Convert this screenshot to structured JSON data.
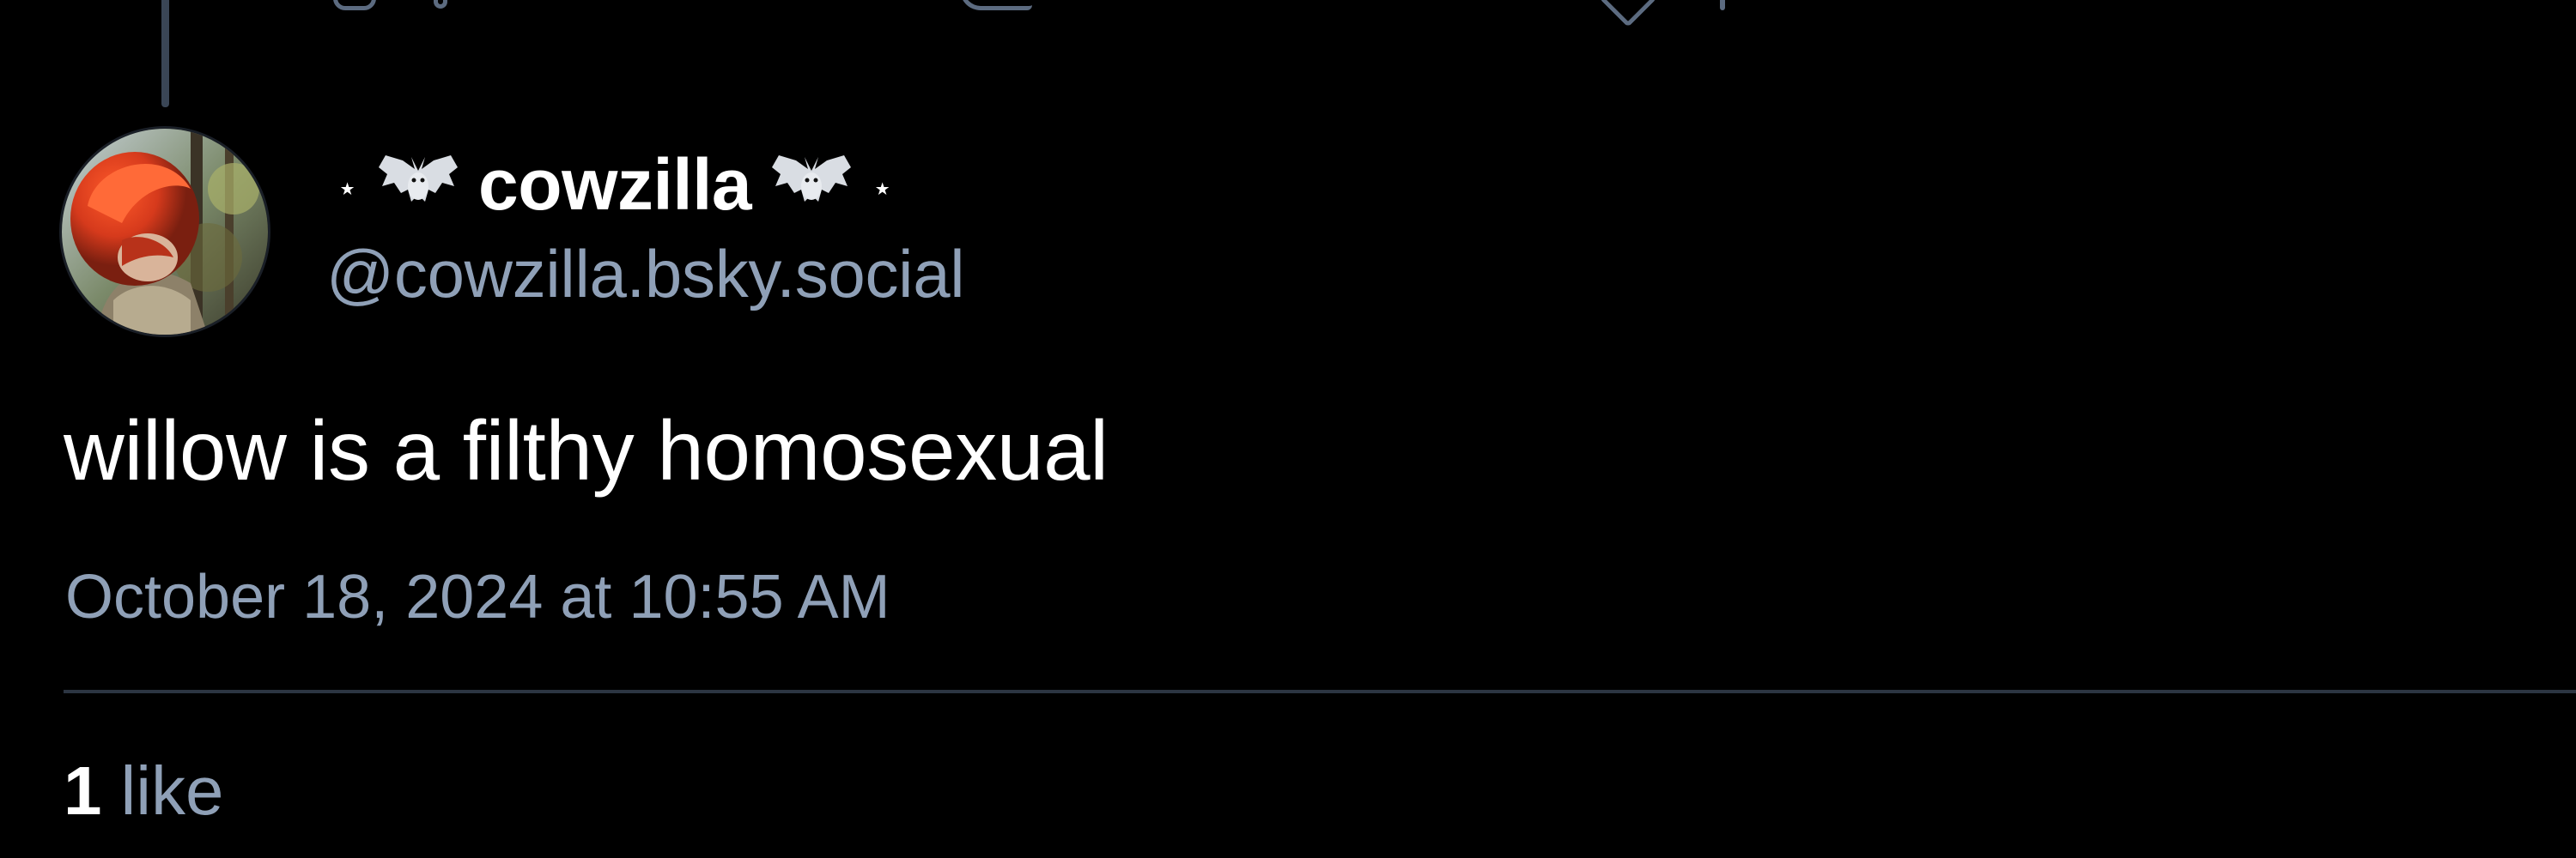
{
  "previous_post": {
    "actions": {
      "reply_icon": "reply-icon",
      "repost_icon": "repost-icon",
      "like_icon": "heart-icon"
    }
  },
  "post": {
    "author": {
      "decoration_left": "⋆",
      "decoration_icon": "bat-icon",
      "display_name": "cowzilla",
      "decoration_right": "⋆",
      "handle": "@cowzilla.bsky.social",
      "avatar": "avatar"
    },
    "text": "willow is a filthy homosexual",
    "timestamp": "October 18, 2024 at 10:55 AM",
    "stats": {
      "likes_count": "1",
      "likes_label": "like"
    }
  },
  "colors": {
    "background": "#000000",
    "text_primary": "#ffffff",
    "text_secondary": "#8fa0b7",
    "divider": "#2c3542",
    "thread_line": "#3a4656"
  }
}
